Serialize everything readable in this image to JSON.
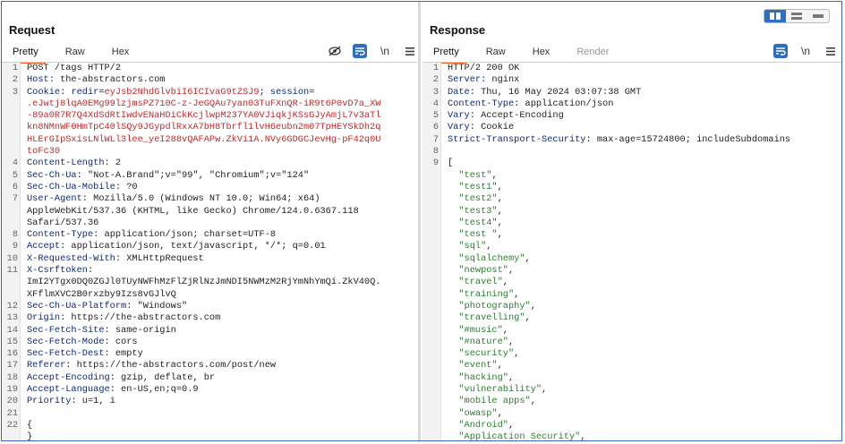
{
  "request": {
    "title": "Request",
    "tabs": [
      "Pretty",
      "Raw",
      "Hex"
    ],
    "lines": [
      {
        "n": "1",
        "parts": [
          {
            "t": "POST /tags HTTP/2",
            "c": "plain"
          }
        ]
      },
      {
        "n": "2",
        "parts": [
          {
            "t": "Host",
            "c": "hdr"
          },
          {
            "t": ": the-abstractors.com",
            "c": "plain"
          }
        ]
      },
      {
        "n": "3",
        "parts": [
          {
            "t": "Cookie",
            "c": "hdr"
          },
          {
            "t": ": ",
            "c": "plain"
          },
          {
            "t": "redir",
            "c": "hdr"
          },
          {
            "t": "=",
            "c": "plain"
          },
          {
            "t": "eyJsb2NhdGlvbiI6ICIvaG9tZSJ9",
            "c": "red"
          },
          {
            "t": "; ",
            "c": "plain"
          },
          {
            "t": "session",
            "c": "hdr"
          },
          {
            "t": "=",
            "c": "plain"
          }
        ]
      },
      {
        "n": "",
        "parts": [
          {
            "t": ".eJwtj8lqA0EMg99lzjmsPZ710C-z-JeGQAu7yan03TuFXnQR-iR9t6P0vD7a_XW",
            "c": "red"
          }
        ]
      },
      {
        "n": "",
        "parts": [
          {
            "t": "-89a0R7R7Q4XdSdRtIwdvENaHDiCkKcjlwpM237YA0VJiqkjKSsGJyAmjL7v3aTl",
            "c": "red"
          }
        ]
      },
      {
        "n": "",
        "parts": [
          {
            "t": "kn8NMnWF0HmTpC40lSQy9JGypdlRxxA7bH8Tbrfl1lvH6eubn2m07TpHEYSkDh2q",
            "c": "red"
          }
        ]
      },
      {
        "n": "",
        "parts": [
          {
            "t": "HLErGIpSxisLNlWLl3lee_yeI288vQAFAPw.ZkVi1A.NVy6GDGCJevHg-pF42q0U",
            "c": "red"
          }
        ]
      },
      {
        "n": "",
        "parts": [
          {
            "t": "toFc30",
            "c": "red"
          }
        ]
      },
      {
        "n": "4",
        "parts": [
          {
            "t": "Content-Length",
            "c": "hdr"
          },
          {
            "t": ": 2",
            "c": "plain"
          }
        ]
      },
      {
        "n": "5",
        "parts": [
          {
            "t": "Sec-Ch-Ua",
            "c": "hdr"
          },
          {
            "t": ": \"Not-A.Brand\";v=\"99\", \"Chromium\";v=\"124\"",
            "c": "plain"
          }
        ]
      },
      {
        "n": "6",
        "parts": [
          {
            "t": "Sec-Ch-Ua-Mobile",
            "c": "hdr"
          },
          {
            "t": ": ?0",
            "c": "plain"
          }
        ]
      },
      {
        "n": "7",
        "parts": [
          {
            "t": "User-Agent",
            "c": "hdr"
          },
          {
            "t": ": Mozilla/5.0 (Windows NT 10.0; Win64; x64)",
            "c": "plain"
          }
        ]
      },
      {
        "n": "",
        "parts": [
          {
            "t": "AppleWebKit/537.36 (KHTML, like Gecko) Chrome/124.0.6367.118",
            "c": "plain"
          }
        ]
      },
      {
        "n": "",
        "parts": [
          {
            "t": "Safari/537.36",
            "c": "plain"
          }
        ]
      },
      {
        "n": "8",
        "parts": [
          {
            "t": "Content-Type",
            "c": "hdr"
          },
          {
            "t": ": application/json; charset=UTF-8",
            "c": "plain"
          }
        ]
      },
      {
        "n": "9",
        "parts": [
          {
            "t": "Accept",
            "c": "hdr"
          },
          {
            "t": ": application/json, text/javascript, */*; q=0.01",
            "c": "plain"
          }
        ]
      },
      {
        "n": "10",
        "parts": [
          {
            "t": "X-Requested-With",
            "c": "hdr"
          },
          {
            "t": ": XMLHttpRequest",
            "c": "plain"
          }
        ]
      },
      {
        "n": "11",
        "parts": [
          {
            "t": "X-Csrftoken",
            "c": "hdr"
          },
          {
            "t": ":",
            "c": "plain"
          }
        ]
      },
      {
        "n": "",
        "parts": [
          {
            "t": "ImI2YTgx0DQ0ZGJl0TUyNWFhMzFlZjRlNzJmNDI5NWMzM2RjYmNhYmQi.ZkV40Q.",
            "c": "plain"
          }
        ]
      },
      {
        "n": "",
        "parts": [
          {
            "t": "XFflmXVC2B0rxzby9Izs8vGJlvQ",
            "c": "plain"
          }
        ]
      },
      {
        "n": "12",
        "parts": [
          {
            "t": "Sec-Ch-Ua-Platform",
            "c": "hdr"
          },
          {
            "t": ": \"Windows\"",
            "c": "plain"
          }
        ]
      },
      {
        "n": "13",
        "parts": [
          {
            "t": "Origin",
            "c": "hdr"
          },
          {
            "t": ": https://the-abstractors.com",
            "c": "plain"
          }
        ]
      },
      {
        "n": "14",
        "parts": [
          {
            "t": "Sec-Fetch-Site",
            "c": "hdr"
          },
          {
            "t": ": same-origin",
            "c": "plain"
          }
        ]
      },
      {
        "n": "15",
        "parts": [
          {
            "t": "Sec-Fetch-Mode",
            "c": "hdr"
          },
          {
            "t": ": cors",
            "c": "plain"
          }
        ]
      },
      {
        "n": "16",
        "parts": [
          {
            "t": "Sec-Fetch-Dest",
            "c": "hdr"
          },
          {
            "t": ": empty",
            "c": "plain"
          }
        ]
      },
      {
        "n": "17",
        "parts": [
          {
            "t": "Referer",
            "c": "hdr"
          },
          {
            "t": ": https://the-abstractors.com/post/new",
            "c": "plain"
          }
        ]
      },
      {
        "n": "18",
        "parts": [
          {
            "t": "Accept-Encoding",
            "c": "hdr"
          },
          {
            "t": ": gzip, deflate, br",
            "c": "plain"
          }
        ]
      },
      {
        "n": "19",
        "parts": [
          {
            "t": "Accept-Language",
            "c": "hdr"
          },
          {
            "t": ": en-US,en;q=0.9",
            "c": "plain"
          }
        ]
      },
      {
        "n": "20",
        "parts": [
          {
            "t": "Priority",
            "c": "hdr"
          },
          {
            "t": ": u=1, i",
            "c": "plain"
          }
        ]
      },
      {
        "n": "21",
        "parts": [
          {
            "t": "",
            "c": "plain"
          }
        ]
      },
      {
        "n": "22",
        "parts": [
          {
            "t": "{",
            "c": "plain"
          }
        ]
      },
      {
        "n": "",
        "parts": [
          {
            "t": "}",
            "c": "plain"
          }
        ]
      }
    ]
  },
  "response": {
    "title": "Response",
    "tabs": [
      "Pretty",
      "Raw",
      "Hex",
      "Render"
    ],
    "lines": [
      {
        "n": "1",
        "parts": [
          {
            "t": "HTTP/2 200 OK",
            "c": "plain"
          }
        ]
      },
      {
        "n": "2",
        "parts": [
          {
            "t": "Server",
            "c": "hdr"
          },
          {
            "t": ": nginx",
            "c": "plain"
          }
        ]
      },
      {
        "n": "3",
        "parts": [
          {
            "t": "Date",
            "c": "hdr"
          },
          {
            "t": ": Thu, 16 May 2024 03:07:38 GMT",
            "c": "plain"
          }
        ]
      },
      {
        "n": "4",
        "parts": [
          {
            "t": "Content-Type",
            "c": "hdr"
          },
          {
            "t": ": application/json",
            "c": "plain"
          }
        ]
      },
      {
        "n": "5",
        "parts": [
          {
            "t": "Vary",
            "c": "hdr"
          },
          {
            "t": ": Accept-Encoding",
            "c": "plain"
          }
        ]
      },
      {
        "n": "6",
        "parts": [
          {
            "t": "Vary",
            "c": "hdr"
          },
          {
            "t": ": Cookie",
            "c": "plain"
          }
        ]
      },
      {
        "n": "7",
        "parts": [
          {
            "t": "Strict-Transport-Security",
            "c": "hdr"
          },
          {
            "t": ": max-age=15724800; includeSubdomains",
            "c": "plain"
          }
        ]
      },
      {
        "n": "8",
        "parts": [
          {
            "t": "",
            "c": "plain"
          }
        ]
      },
      {
        "n": "9",
        "parts": [
          {
            "t": "[",
            "c": "plain"
          }
        ]
      },
      {
        "n": "",
        "parts": [
          {
            "t": "  \"test\"",
            "c": "str"
          },
          {
            "t": ",",
            "c": "plain"
          }
        ]
      },
      {
        "n": "",
        "parts": [
          {
            "t": "  \"test1\"",
            "c": "str"
          },
          {
            "t": ",",
            "c": "plain"
          }
        ]
      },
      {
        "n": "",
        "parts": [
          {
            "t": "  \"test2\"",
            "c": "str"
          },
          {
            "t": ",",
            "c": "plain"
          }
        ]
      },
      {
        "n": "",
        "parts": [
          {
            "t": "  \"test3\"",
            "c": "str"
          },
          {
            "t": ",",
            "c": "plain"
          }
        ]
      },
      {
        "n": "",
        "parts": [
          {
            "t": "  \"test4\"",
            "c": "str"
          },
          {
            "t": ",",
            "c": "plain"
          }
        ]
      },
      {
        "n": "",
        "parts": [
          {
            "t": "  \"test \"",
            "c": "str"
          },
          {
            "t": ",",
            "c": "plain"
          }
        ]
      },
      {
        "n": "",
        "parts": [
          {
            "t": "  \"sql\"",
            "c": "str"
          },
          {
            "t": ",",
            "c": "plain"
          }
        ]
      },
      {
        "n": "",
        "parts": [
          {
            "t": "  \"sqlalchemy\"",
            "c": "str"
          },
          {
            "t": ",",
            "c": "plain"
          }
        ]
      },
      {
        "n": "",
        "parts": [
          {
            "t": "  \"newpost\"",
            "c": "str"
          },
          {
            "t": ",",
            "c": "plain"
          }
        ]
      },
      {
        "n": "",
        "parts": [
          {
            "t": "  \"travel\"",
            "c": "str"
          },
          {
            "t": ",",
            "c": "plain"
          }
        ]
      },
      {
        "n": "",
        "parts": [
          {
            "t": "  \"training\"",
            "c": "str"
          },
          {
            "t": ",",
            "c": "plain"
          }
        ]
      },
      {
        "n": "",
        "parts": [
          {
            "t": "  \"photography\"",
            "c": "str"
          },
          {
            "t": ",",
            "c": "plain"
          }
        ]
      },
      {
        "n": "",
        "parts": [
          {
            "t": "  \"travelling\"",
            "c": "str"
          },
          {
            "t": ",",
            "c": "plain"
          }
        ]
      },
      {
        "n": "",
        "parts": [
          {
            "t": "  \"#music\"",
            "c": "str"
          },
          {
            "t": ",",
            "c": "plain"
          }
        ]
      },
      {
        "n": "",
        "parts": [
          {
            "t": "  \"#nature\"",
            "c": "str"
          },
          {
            "t": ",",
            "c": "plain"
          }
        ]
      },
      {
        "n": "",
        "parts": [
          {
            "t": "  \"security\"",
            "c": "str"
          },
          {
            "t": ",",
            "c": "plain"
          }
        ]
      },
      {
        "n": "",
        "parts": [
          {
            "t": "  \"event\"",
            "c": "str"
          },
          {
            "t": ",",
            "c": "plain"
          }
        ]
      },
      {
        "n": "",
        "parts": [
          {
            "t": "  \"hacking\"",
            "c": "str"
          },
          {
            "t": ",",
            "c": "plain"
          }
        ]
      },
      {
        "n": "",
        "parts": [
          {
            "t": "  \"vulnerability\"",
            "c": "str"
          },
          {
            "t": ",",
            "c": "plain"
          }
        ]
      },
      {
        "n": "",
        "parts": [
          {
            "t": "  \"mobile apps\"",
            "c": "str"
          },
          {
            "t": ",",
            "c": "plain"
          }
        ]
      },
      {
        "n": "",
        "parts": [
          {
            "t": "  \"owasp\"",
            "c": "str"
          },
          {
            "t": ",",
            "c": "plain"
          }
        ]
      },
      {
        "n": "",
        "parts": [
          {
            "t": "  \"Android\"",
            "c": "str"
          },
          {
            "t": ",",
            "c": "plain"
          }
        ]
      },
      {
        "n": "",
        "parts": [
          {
            "t": "  \"Application Security\"",
            "c": "str"
          },
          {
            "t": ",",
            "c": "plain"
          }
        ]
      }
    ]
  },
  "icons": {
    "hide": "eye-slash-icon",
    "wrap": "wrap-lines-icon",
    "newline": "\\n",
    "menu": "hamburger-menu-icon"
  },
  "colors": {
    "header_name": "#0b2a7a",
    "cookie_value": "#c62828",
    "json_string": "#2e7d32",
    "accent_tab": "#e8601c",
    "toggle_active": "#2f6fbf"
  }
}
